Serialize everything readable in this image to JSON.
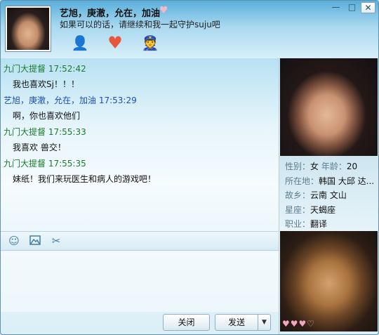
{
  "window": {
    "title": "艺旭，庚澈，允在，加油",
    "status": "如果可以的话，请继续和我一起守护suju吧",
    "controls": {
      "minimize": "—",
      "maximize": "□",
      "close": "✕"
    }
  },
  "icons": {
    "title_heart": "♥",
    "toolbar": [
      "user-add-icon",
      "heart-icon",
      "police-icon"
    ]
  },
  "messages": [
    {
      "sender": "九门大提督",
      "time": "17:52:42",
      "text": "我也喜欢Sj！！！",
      "color": "#1a7d2b"
    },
    {
      "sender": "艺旭，庚澈，允在，加油",
      "time": "17:53:29",
      "text": "啊，你也喜欢他们",
      "color": "#1e4eb8"
    },
    {
      "sender": "九门大提督",
      "time": "17:55:33",
      "text": "我喜欢 兽交！",
      "color": "#1a7d2b"
    },
    {
      "sender": "九门大提督",
      "time": "17:55:35",
      "text": "妹纸！我们来玩医生和病人的游戏吧！",
      "color": "#1a7d2b"
    }
  ],
  "input_toolbar": [
    "smiley-icon",
    "image-icon",
    "scissors-icon"
  ],
  "buttons": {
    "close": "关闭",
    "send": "发送",
    "send_arrow": "▼"
  },
  "profile": {
    "gender_label": "性别：",
    "gender": "女",
    "age_label": "年龄：",
    "age": "20",
    "location_label": "所在地：",
    "location": "韩国 大邱 达...",
    "hometown_label": "故乡：",
    "hometown": "云南 文山",
    "zodiac_label": "星座：",
    "zodiac": "天蝎座",
    "job_label": "职业：",
    "job": "翻译"
  },
  "hearts": "♥♥♥♡"
}
